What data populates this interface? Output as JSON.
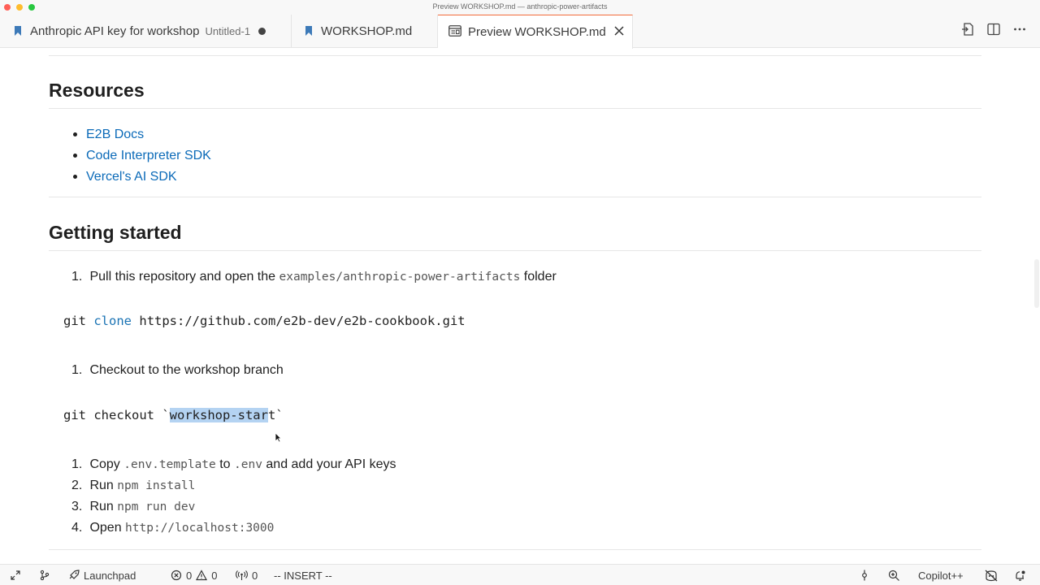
{
  "window": {
    "title": "Preview WORKSHOP.md — anthropic-power-artifacts"
  },
  "tabs": [
    {
      "label": "Anthropic API key for workshop",
      "sub": "Untitled-1",
      "icon": "markdown-icon",
      "dirty": true
    },
    {
      "label": "WORKSHOP.md",
      "icon": "markdown-icon"
    },
    {
      "label": "Preview WORKSHOP.md",
      "icon": "preview-icon",
      "active": true
    }
  ],
  "colors": {
    "link": "#0b6ab8",
    "keyword": "#1a73b4",
    "selection": "#b4d3f2",
    "active_tab_border": "#f26b3a"
  },
  "content": {
    "resources": {
      "heading": "Resources",
      "links": [
        "E2B Docs",
        "Code Interpreter SDK",
        "Vercel's AI SDK"
      ]
    },
    "getting_started": {
      "heading": "Getting started",
      "step1": {
        "num": "1.",
        "text_before": "Pull this repository and open the",
        "code": "examples/anthropic-power-artifacts",
        "text_after": "folder"
      },
      "code1": {
        "cmd": "git",
        "kw": "clone",
        "arg": "https://github.com/e2b-dev/e2b-cookbook.git"
      },
      "step2": {
        "num": "1.",
        "text": "Checkout to the workshop branch"
      },
      "code2": {
        "prefix": "git checkout `",
        "selected": "workshop-star",
        "rest": "t",
        "suffix": "`"
      },
      "steps": [
        {
          "num": "1.",
          "before": "Copy",
          "code1": ".env.template",
          "mid": "to",
          "code2": ".env",
          "after": "and add your API keys"
        },
        {
          "num": "2.",
          "before": "Run",
          "code": "npm install"
        },
        {
          "num": "3.",
          "before": "Run",
          "code": "npm run dev"
        },
        {
          "num": "4.",
          "before": "Open",
          "code": "http://localhost:3000"
        }
      ]
    }
  },
  "statusbar": {
    "launchpad": "Launchpad",
    "errors": "0",
    "warnings": "0",
    "ports": "0",
    "mode": "-- INSERT --",
    "copilot": "Copilot++"
  }
}
